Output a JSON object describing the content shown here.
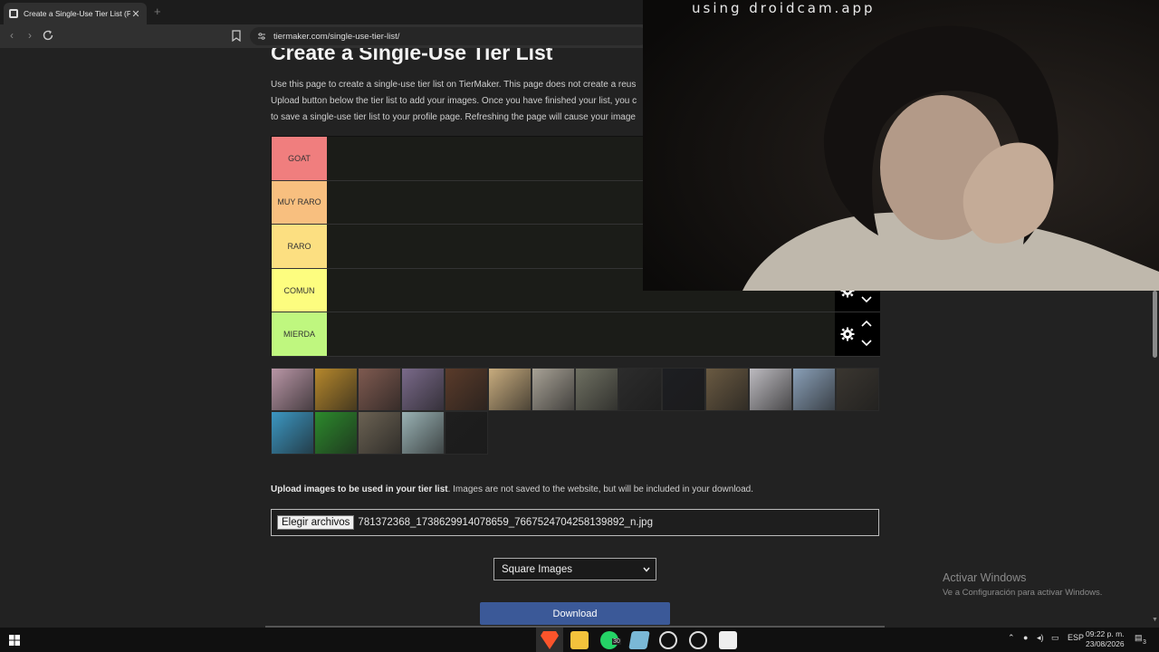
{
  "browser": {
    "tab_title": "Create a Single-Use Tier List (Pri",
    "tab_close": "✕",
    "new_tab": "+",
    "url": "tiermaker.com/single-use-tier-list/"
  },
  "page": {
    "title": "Create a Single-Use Tier List",
    "intro_lines": [
      "Use this page to create a single-use tier list on TierMaker. This page does not create a reus",
      "Upload button below the tier list to add your images. Once you have finished your list, you c",
      "to save a single-use tier list to your profile page. Refreshing the page will cause your image"
    ],
    "tiers": [
      {
        "label": "GOAT",
        "color": "#f07e7e"
      },
      {
        "label": "MUY RARO",
        "color": "#f8bf7f"
      },
      {
        "label": "RARO",
        "color": "#fcdf81"
      },
      {
        "label": "COMUN",
        "color": "#fdfd7f"
      },
      {
        "label": "MIERDA",
        "color": "#bff77f"
      }
    ],
    "upload_bold": "Upload images to be used in your tier list",
    "upload_rest": ". Images are not saved to the website, but will be included in your download.",
    "file_button": "Elegir archivos",
    "file_name": "781372368_1738629914078659_7667524704258139892_n.jpg",
    "select_value": "Square Images",
    "download_label": "Download"
  },
  "thumbnails": [
    {
      "name": "pink-dress",
      "color": "#b996a6"
    },
    {
      "name": "curly-hair-yellow",
      "color": "#b6882c"
    },
    {
      "name": "red-cap",
      "color": "#7f5a50"
    },
    {
      "name": "flower",
      "color": "#7a6a8a"
    },
    {
      "name": "colorful-shelf",
      "color": "#5a3b2a"
    },
    {
      "name": "braided-bread",
      "color": "#c8ac7e"
    },
    {
      "name": "plush-toy",
      "color": "#a8a296"
    },
    {
      "name": "plant-pot",
      "color": "#6f7062"
    },
    {
      "name": "sico-box",
      "color": "#2c2c2c"
    },
    {
      "name": "dark-hair-face",
      "color": "#1d1e22"
    },
    {
      "name": "figure-hand",
      "color": "#6a5a42"
    },
    {
      "name": "id-card",
      "color": "#bdbbc0"
    },
    {
      "name": "striped-pole",
      "color": "#8aa0b8"
    },
    {
      "name": "bottle",
      "color": "#3a3630"
    },
    {
      "name": "twitter-bird",
      "color": "#3c97c2"
    },
    {
      "name": "green-blob",
      "color": "#2c8a2c"
    },
    {
      "name": "person-jacket",
      "color": "#6b6253"
    },
    {
      "name": "rainbow-hair",
      "color": "#9ab2b4"
    },
    {
      "name": "dark-spider",
      "color": "#1e1e1e"
    }
  ],
  "overlay": {
    "caption": "using droidcam.app"
  },
  "windows": {
    "activate_title": "Activar Windows",
    "activate_sub": "Ve a Configuración para activar Windows."
  },
  "taskbar": {
    "language": "ESP",
    "time": "09:22 p. m.",
    "date": "23/08/2026",
    "whatsapp_badge": "30",
    "notif_count": "3"
  },
  "colors": {
    "download_button": "#3b5998",
    "page_bg": "#222222"
  }
}
